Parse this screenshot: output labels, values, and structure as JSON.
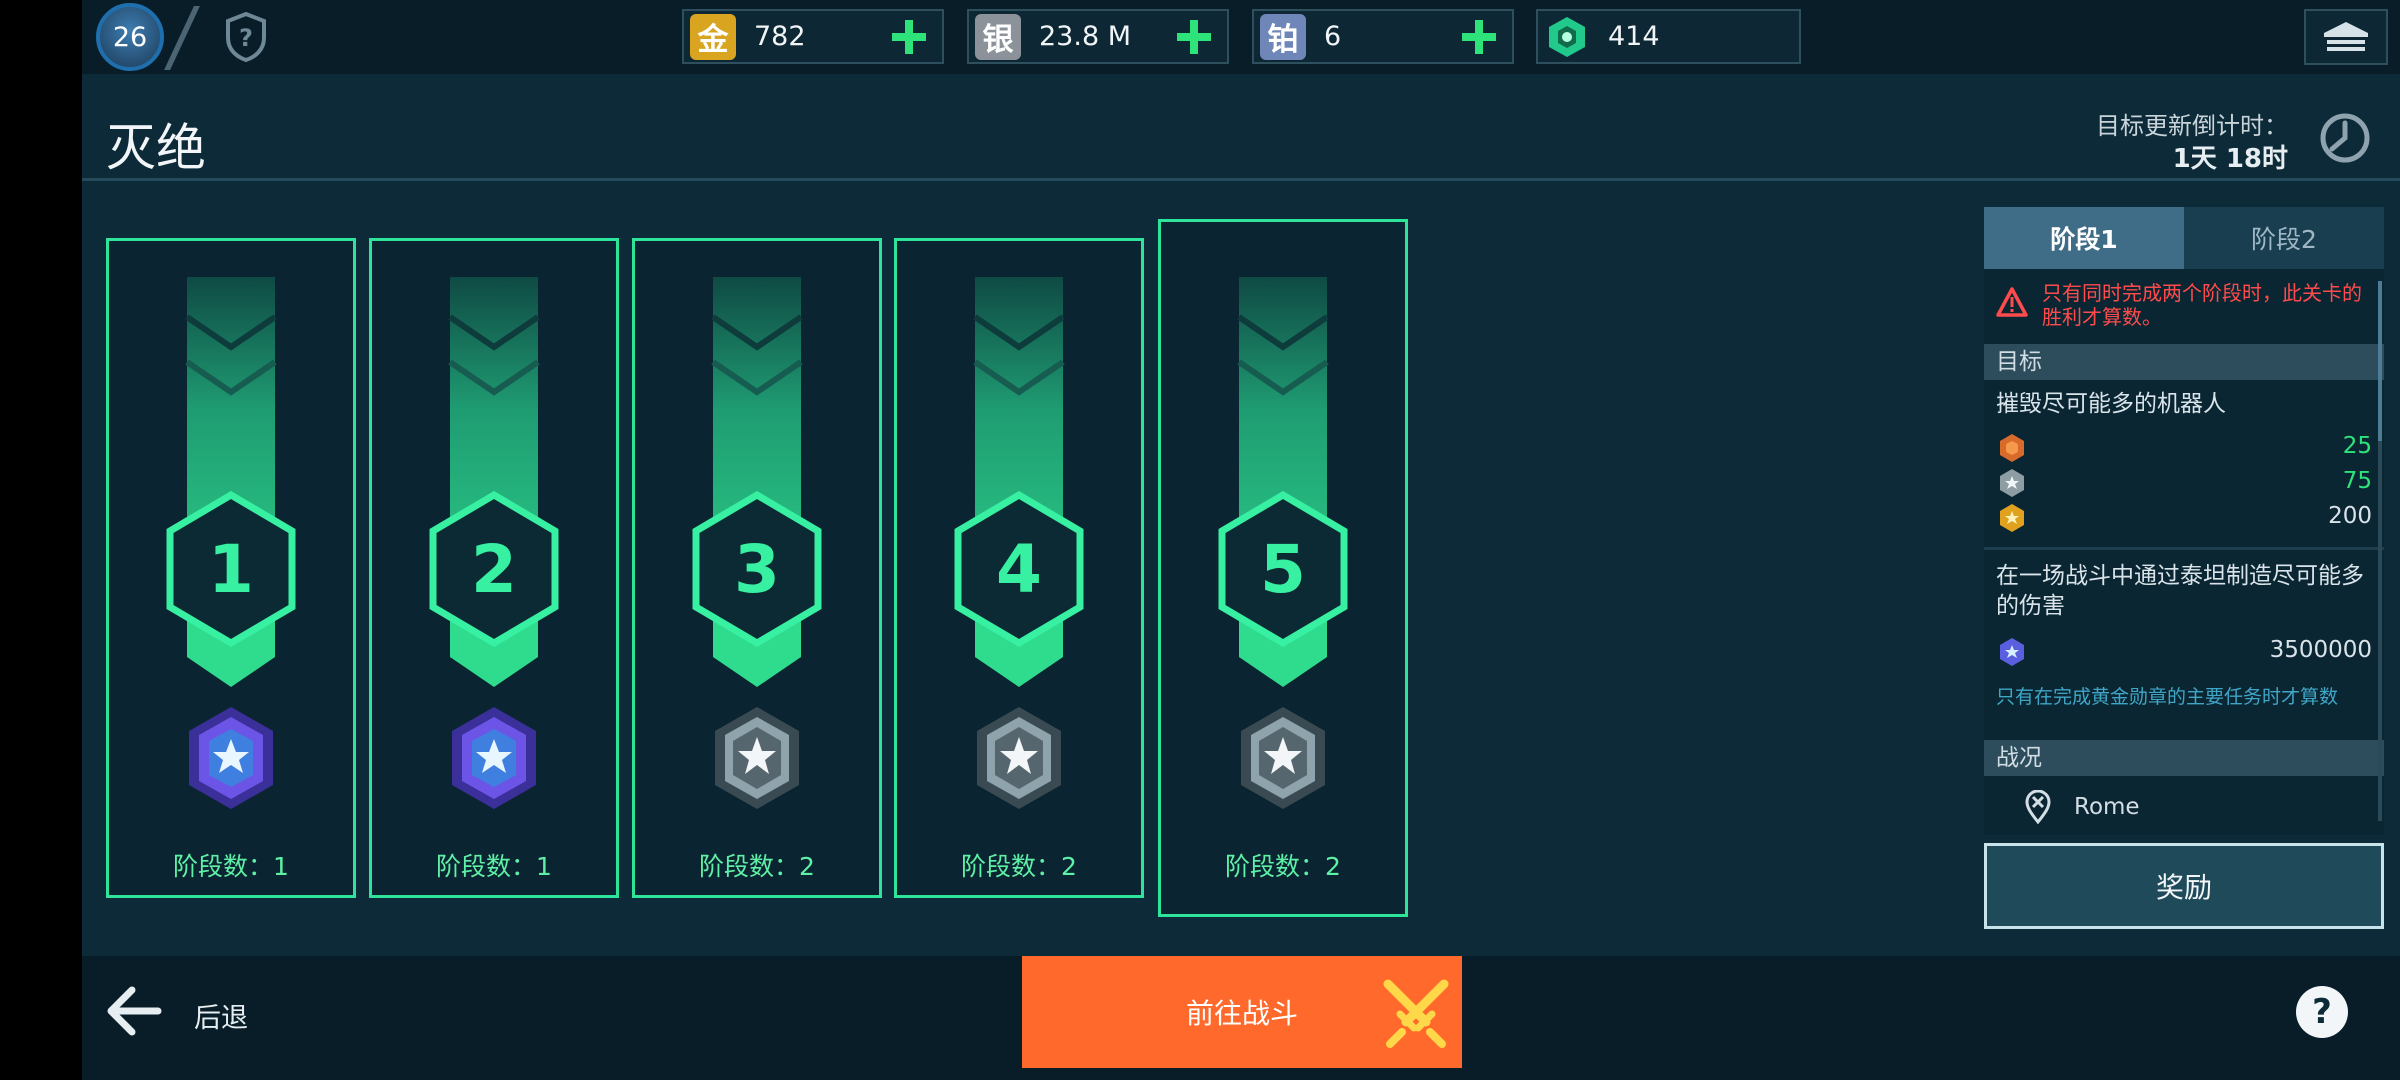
{
  "topbar": {
    "player_level": "26",
    "currencies": [
      {
        "icon_char": "金",
        "icon": "gold-icon",
        "value": "782",
        "color": "#d9a520",
        "has_plus": true
      },
      {
        "icon_char": "银",
        "icon": "silver-icon",
        "value": "23.8 M",
        "color": "#8b9299",
        "has_plus": true
      },
      {
        "icon_char": "铂",
        "icon": "platinum-icon",
        "value": "6",
        "color": "#6f86b8",
        "has_plus": true
      },
      {
        "icon_char": "",
        "icon": "power-cell-icon",
        "value": "414",
        "color": "#21c98a",
        "has_plus": false
      }
    ]
  },
  "header": {
    "title": "灭绝",
    "timer_label": "目标更新倒计时：",
    "timer_value": "1天 18时"
  },
  "stages": [
    {
      "number": "1",
      "label": "阶段数：1",
      "medal": "platinum"
    },
    {
      "number": "2",
      "label": "阶段数：1",
      "medal": "platinum"
    },
    {
      "number": "3",
      "label": "阶段数：2",
      "medal": "silver"
    },
    {
      "number": "4",
      "label": "阶段数：2",
      "medal": "silver"
    },
    {
      "number": "5",
      "label": "阶段数：2",
      "medal": "silver"
    }
  ],
  "panel": {
    "tabs": [
      {
        "label": "阶段1",
        "active": true
      },
      {
        "label": "阶段2",
        "active": false
      }
    ],
    "warning": "只有同时完成两个阶段时，此关卡的胜利才算数。",
    "objectives_header": "目标",
    "objective1": {
      "text": "摧毁尽可能多的机器人",
      "rewards": [
        {
          "medal": "bronze",
          "value": "25",
          "color": "#2ee37a"
        },
        {
          "medal": "silver",
          "value": "75",
          "color": "#2ee37a"
        },
        {
          "medal": "gold",
          "value": "200",
          "color": "#d9e4ea"
        }
      ]
    },
    "objective2": {
      "text": "在一场战斗中通过泰坦制造尽可能多的伤害",
      "rewards": [
        {
          "medal": "platinum",
          "value": "3500000",
          "color": "#d9e4ea"
        }
      ],
      "note": "只有在完成黄金勋章的主要任务时才算数"
    },
    "battle_header": "战况",
    "location": "Rome",
    "reward_button": "奖励"
  },
  "bottombar": {
    "back_label": "后退",
    "battle_button": "前往战斗"
  },
  "colors": {
    "accent_green": "#2ee39a",
    "battle_orange": "#ff6a2c",
    "warning_red": "#ff4b4b"
  }
}
